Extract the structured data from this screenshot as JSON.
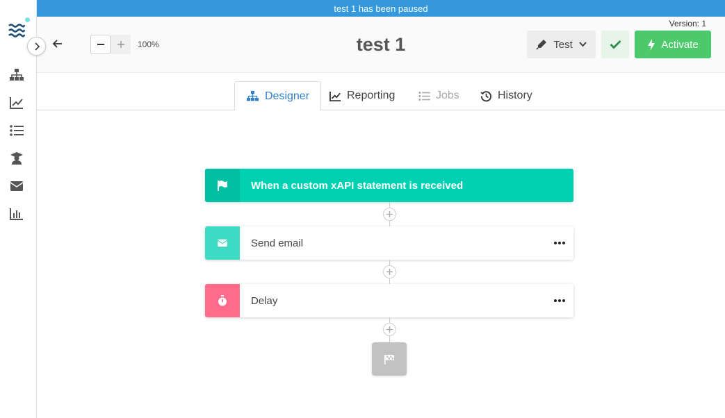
{
  "banner": {
    "text": "test 1 has been paused"
  },
  "sidebar": {
    "items": [
      {
        "name": "flow-icon"
      },
      {
        "name": "analytics-icon"
      },
      {
        "name": "list-icon"
      },
      {
        "name": "learner-icon"
      },
      {
        "name": "mail-icon"
      },
      {
        "name": "bar-chart-icon"
      }
    ]
  },
  "topbar": {
    "zoom_level": "100%",
    "title": "test 1",
    "version": "Version: 1",
    "test_label": "Test",
    "activate_label": "Activate"
  },
  "tabs": [
    {
      "label": "Designer",
      "state": "active"
    },
    {
      "label": "Reporting",
      "state": "normal"
    },
    {
      "label": "Jobs",
      "state": "disabled"
    },
    {
      "label": "History",
      "state": "normal"
    }
  ],
  "flow": {
    "trigger": {
      "label": "When a custom xAPI statement is received",
      "icon": "flag-icon"
    },
    "steps": [
      {
        "label": "Send email",
        "icon": "mail-icon",
        "color": "#3ddbc4"
      },
      {
        "label": "Delay",
        "icon": "stopwatch-icon",
        "color": "#ff6b8a"
      }
    ],
    "end_icon": "finish-flag-icon"
  },
  "colors": {
    "banner": "#3498db",
    "trigger": "#00d1b2",
    "activate": "#4bc96b",
    "active_tab": "#2f7fc6"
  }
}
